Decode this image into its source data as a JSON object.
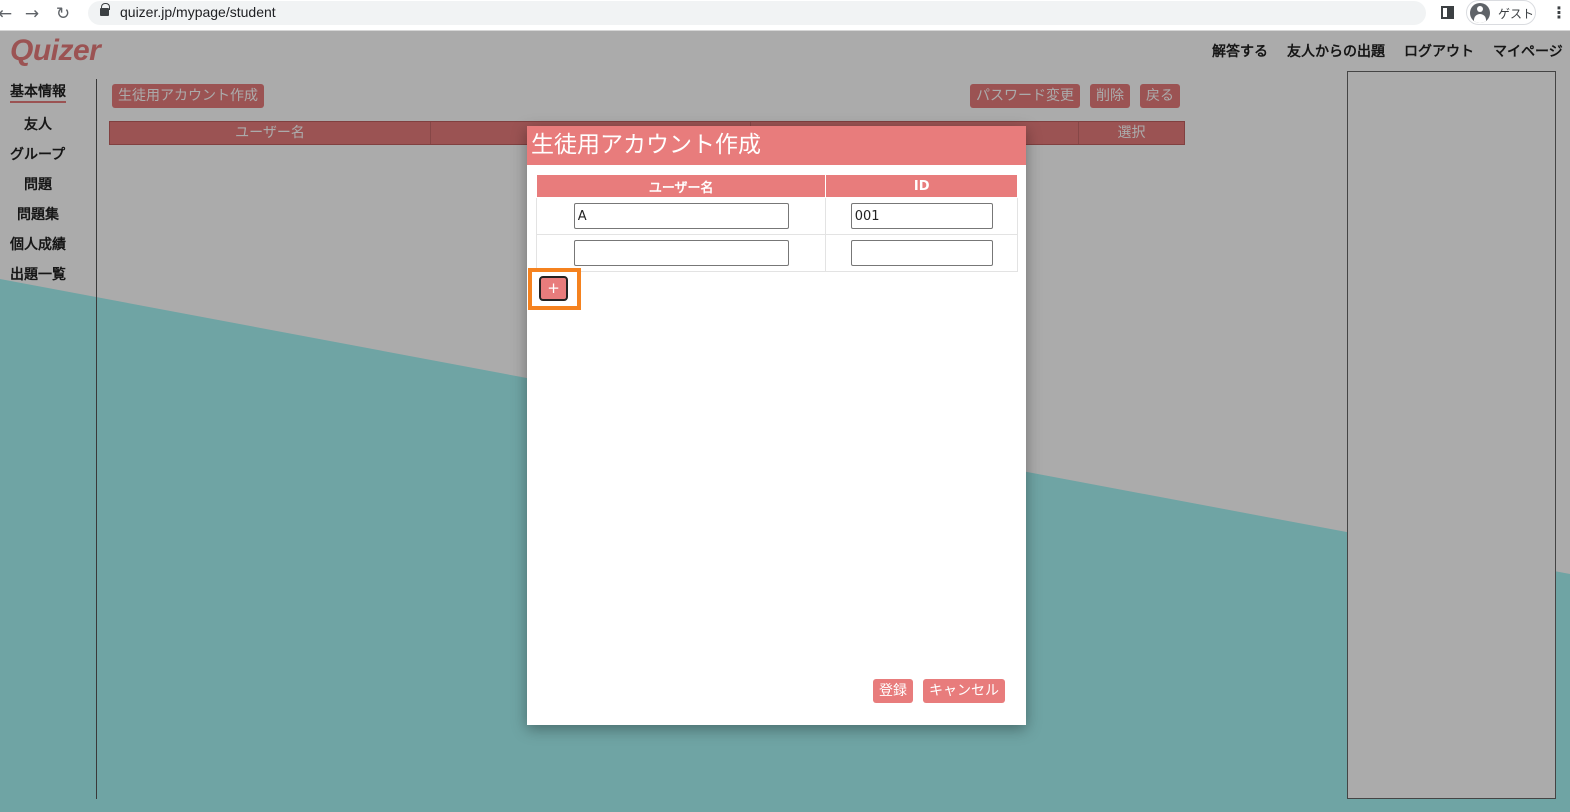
{
  "browser": {
    "url": "quizer.jp/mypage/student",
    "profile_name": "ゲスト",
    "back_icon": "back-arrow-icon",
    "forward_icon": "forward-arrow-icon",
    "reload_icon": "reload-icon",
    "menu_icon": "kebab-menu-icon"
  },
  "app": {
    "logo": "Quizer",
    "colors": {
      "accent": "#e87c7c",
      "teal": "#6aa7a5",
      "highlight": "#f5821f"
    },
    "top_nav": [
      "解答する",
      "友人からの出題",
      "ログアウト",
      "マイページ"
    ]
  },
  "sidebar": {
    "items": [
      "基本情報",
      "友人",
      "グループ",
      "問題",
      "問題集",
      "個人成績",
      "出題一覧"
    ],
    "active": "基本情報"
  },
  "toolbar": {
    "create_label": "生徒用アカウント作成",
    "password_label": "パスワード変更",
    "delete_label": "削除",
    "back_label": "戻る"
  },
  "main_table": {
    "columns": [
      "ユーザー名",
      "",
      "",
      "選択"
    ]
  },
  "modal": {
    "title": "生徒用アカウント作成",
    "columns": [
      "ユーザー名",
      "ID"
    ],
    "rows": [
      {
        "username": "A",
        "id": "001"
      },
      {
        "username": "",
        "id": ""
      }
    ],
    "add_row_label": "+",
    "register_label": "登録",
    "cancel_label": "キャンセル"
  }
}
